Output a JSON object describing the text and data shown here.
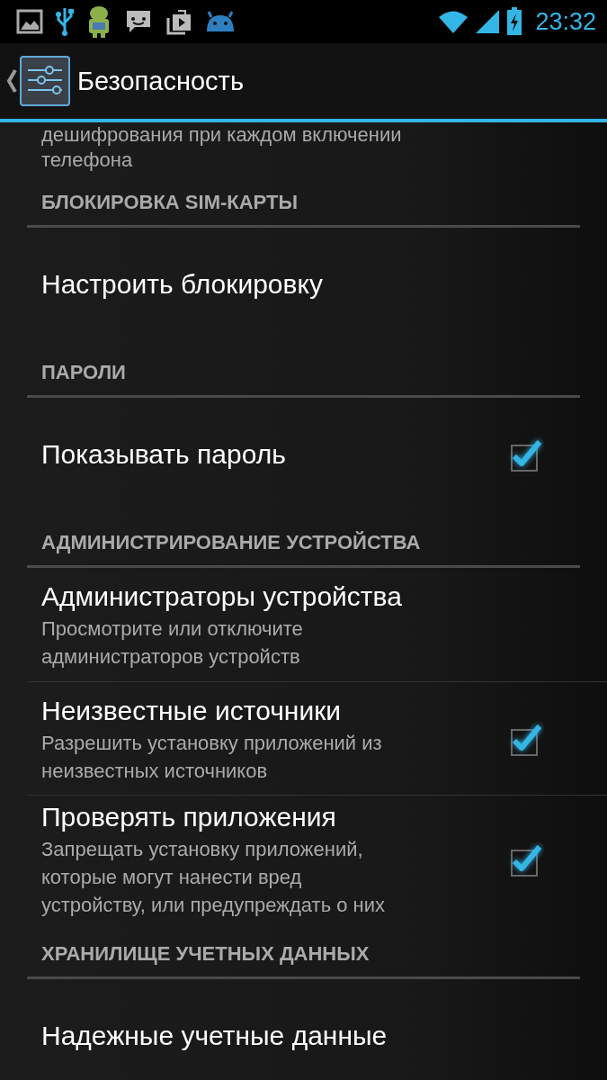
{
  "status_bar": {
    "time": "23:32"
  },
  "action_bar": {
    "title": "Безопасность"
  },
  "preferences": [
    {
      "kind": "fragment",
      "summary": "дешифрования при каждом включении\nтелефона"
    },
    {
      "kind": "category",
      "title": "БЛОКИРОВКА SIM-КАРТЫ"
    },
    {
      "kind": "preference",
      "title": "Настроить блокировку"
    },
    {
      "kind": "category",
      "title": "ПАРОЛИ"
    },
    {
      "kind": "preference",
      "title": "Показывать пароль",
      "checked": true
    },
    {
      "kind": "category",
      "title": "АДМИНИСТРИРОВАНИЕ УСТРОЙСТВА"
    },
    {
      "kind": "preference",
      "title": "Администраторы устройства",
      "summary": "Просмотрите или отключите\nадминистраторов устройств"
    },
    {
      "kind": "preference",
      "title": "Неизвестные источники",
      "summary": "Разрешить установку приложений из\nнеизвестных источников",
      "checked": true
    },
    {
      "kind": "preference",
      "title": "Проверять приложения",
      "summary": "Запрещать установку приложений,\nкоторые могут нанести вред\nустройству, или предупреждать о них",
      "checked": true
    },
    {
      "kind": "category",
      "title": "ХРАНИЛИЩЕ УЧЕТНЫХ ДАННЫХ"
    },
    {
      "kind": "preference",
      "title": "Надежные учетные данные"
    }
  ]
}
